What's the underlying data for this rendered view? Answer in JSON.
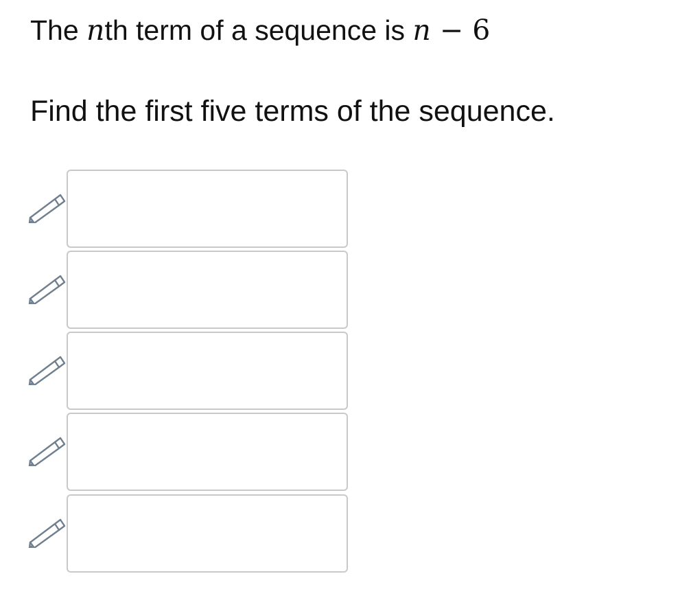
{
  "question": {
    "prefix": "The ",
    "n_var": "n",
    "middle": "th term of a sequence is ",
    "expr_var": "n",
    "expr_rest": " − 6"
  },
  "instruction": "Find the first five terms of the sequence.",
  "answers": [
    {
      "value": ""
    },
    {
      "value": ""
    },
    {
      "value": ""
    },
    {
      "value": ""
    },
    {
      "value": ""
    }
  ],
  "icons": {
    "edit": "pencil-icon"
  }
}
